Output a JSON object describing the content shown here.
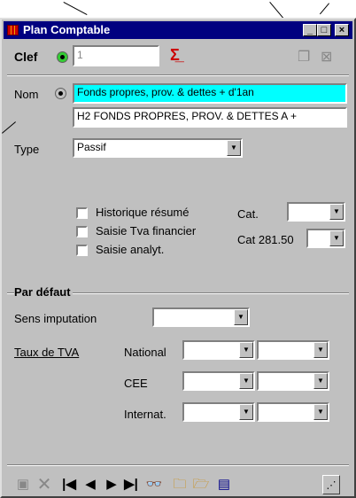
{
  "window": {
    "title": "Plan Comptable",
    "min": "_",
    "max": "□",
    "close": "×"
  },
  "clef": {
    "label": "Clef",
    "value": "1"
  },
  "nom": {
    "label": "Nom",
    "value1": "Fonds propres, prov. & dettes + d'1an",
    "value2": "H2 FONDS PROPRES, PROV. & DETTES A +"
  },
  "type": {
    "label": "Type",
    "value": "Passif"
  },
  "checks": {
    "historique": "Historique résumé",
    "tva_fin": "Saisie Tva financier",
    "analyt": "Saisie analyt."
  },
  "cat": {
    "label": "Cat.",
    "cat281": "Cat 281.50"
  },
  "defaut": {
    "title": "Par défaut",
    "sens": "Sens imputation",
    "taux": "Taux de TVA",
    "national": "National",
    "cee": "CEE",
    "internat": "Internat."
  },
  "colors": {
    "titlebar": "#000080",
    "face": "#c0c0c0",
    "highlight_field": "#00ffff"
  }
}
